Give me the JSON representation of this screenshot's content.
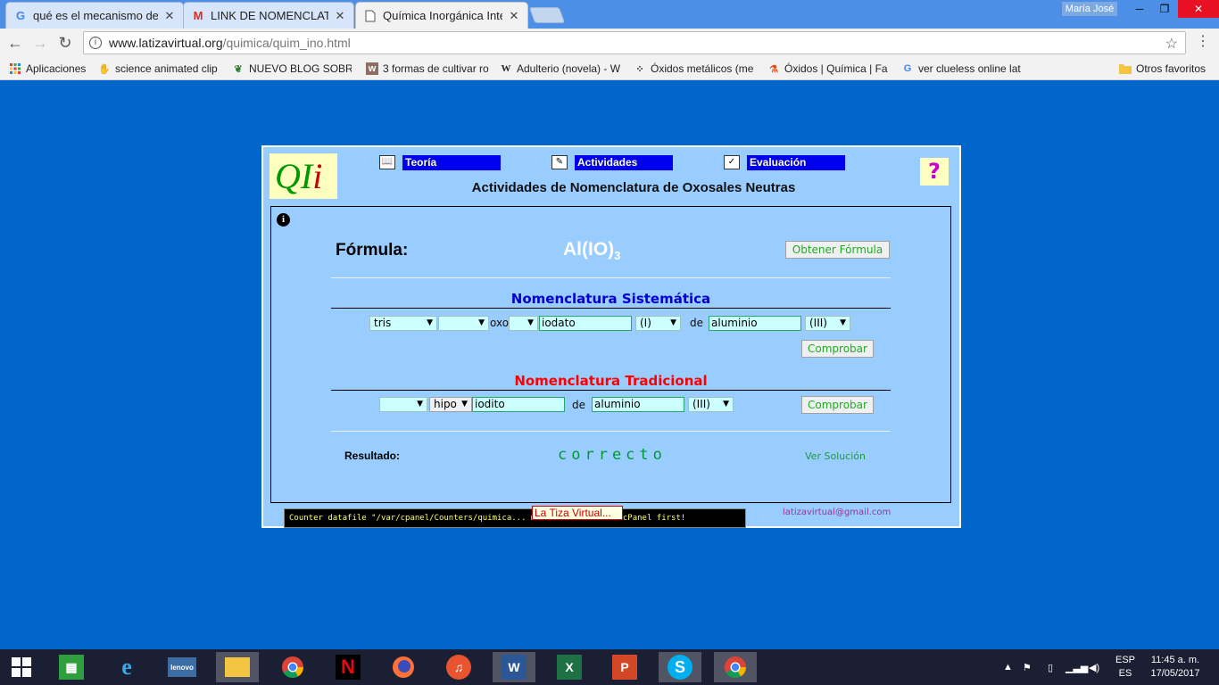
{
  "browser": {
    "tabs": [
      {
        "label": "qué es el mecanismo de",
        "icon": "google-icon",
        "close": "✕"
      },
      {
        "label": "LINK DE NOMENCLATUR",
        "icon": "gmail-icon",
        "close": "✕"
      },
      {
        "label": "Química Inorgánica Inter",
        "icon": "document-icon",
        "close": "✕"
      }
    ],
    "user": "María José",
    "url_host": "www.latizavirtual.org",
    "url_path": "/quimica/quim_ino.html",
    "bookmarks": [
      "Aplicaciones",
      "science animated clip",
      "NUEVO BLOG SOBRE",
      "3 formas de cultivar ro",
      "Adulterio (novela) - W",
      "Óxidos metálicos (me",
      "Óxidos | Química | Fa",
      "ver clueless online lat"
    ],
    "other_bookmarks": "Otros favoritos"
  },
  "page": {
    "logo_q": "QI",
    "logo_i": "i",
    "nav": [
      "Teoría",
      "Actividades",
      "Evaluación"
    ],
    "help": "?",
    "title": "Actividades de Nomenclatura de Oxosales Neutras",
    "info_icon": "i",
    "formula_label": "Fórmula:",
    "formula_main": "Al(IO)",
    "formula_sub": "3",
    "get_formula_button": "Obtener Fórmula",
    "systematic": {
      "heading": "Nomenclatura Sistemática",
      "select1": "tris",
      "select2": "",
      "oxo_text": "oxo",
      "select3": "",
      "anion_value": "iodato",
      "oxstate1": "(I)",
      "de_text": "de",
      "cation_value": "aluminio",
      "oxstate2": "(III)",
      "check_button": "Comprobar"
    },
    "traditional": {
      "heading": "Nomenclatura Tradicional",
      "select1": "",
      "prefix": "hipo",
      "anion_value": "iodito",
      "de_text": "de",
      "cation_value": "aluminio",
      "oxstate": "(III)",
      "check_button": "Comprobar"
    },
    "result_label": "Resultado:",
    "result_value": "correcto",
    "view_solution": "Ver Solución",
    "email": "latizavirtual@gmail.com",
    "counter_text": "Counter datafile \"/var/cpanel/Counters/quimica... must be created in cPanel first!",
    "tooltip": "La Tiza Virtual..."
  },
  "taskbar": {
    "lang_top": "ESP",
    "lang_bottom": "ES",
    "time": "11:45 a. m.",
    "date": "17/05/2017"
  },
  "colors": {
    "page_bg": "#0066cc",
    "panel_bg": "#99ccff",
    "nav_link_bg": "#0000ee",
    "systematic_heading": "#0000cc",
    "traditional_heading": "#ff0000",
    "result_green": "#009933"
  }
}
